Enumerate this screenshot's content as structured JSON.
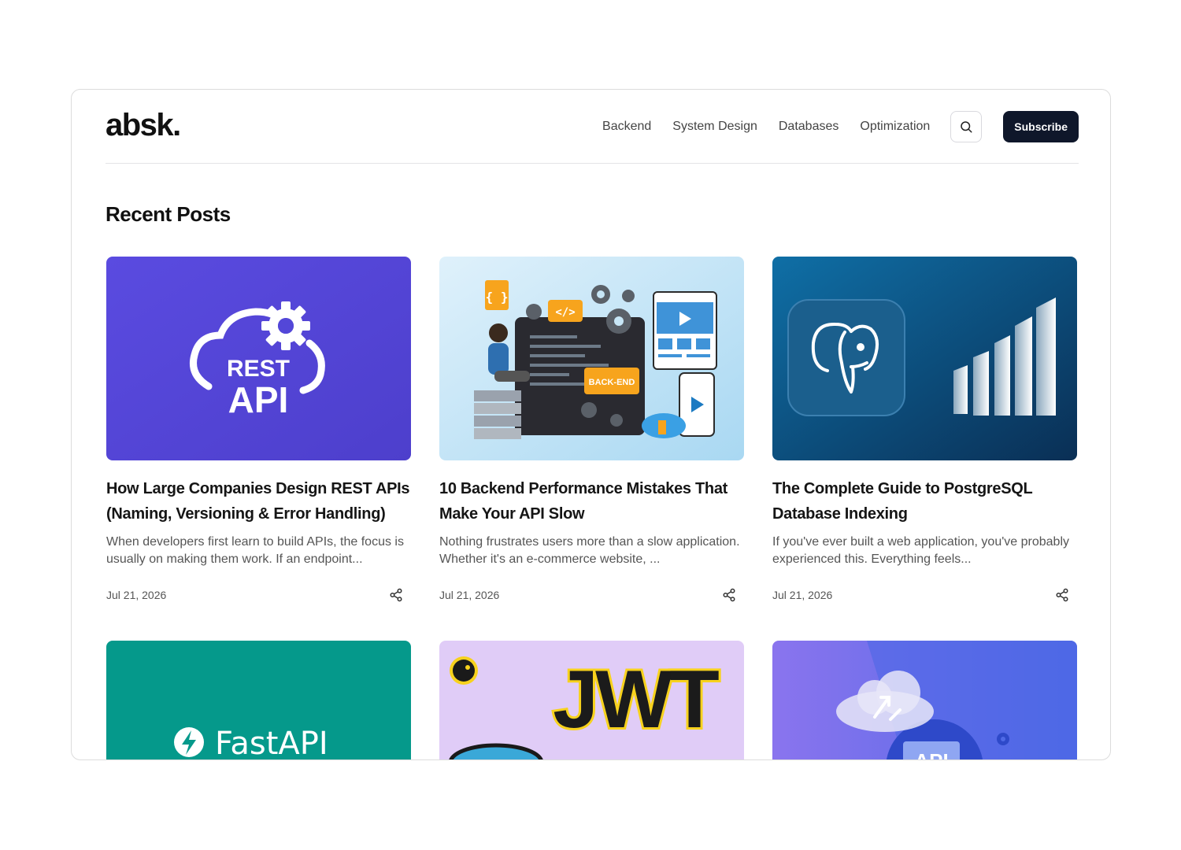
{
  "site": {
    "logo": "absk."
  },
  "nav": {
    "links": [
      "Backend",
      "System Design",
      "Databases",
      "Optimization"
    ],
    "search_icon": "search-icon",
    "subscribe_label": "Subscribe"
  },
  "section": {
    "title": "Recent Posts"
  },
  "posts": [
    {
      "title": "How Large Companies Design REST APIs (Naming, Versioning & Error Handling)",
      "excerpt": "When developers first learn to build APIs, the focus is usually on making them work. If an endpoint...",
      "date": "Jul 21, 2026",
      "thumb_text_1": "REST",
      "thumb_text_2": "API"
    },
    {
      "title": "10 Backend Performance Mistakes That Make Your API Slow",
      "excerpt": "Nothing frustrates users more than a slow application. Whether it's an e-commerce website, ...",
      "date": "Jul 21, 2026",
      "thumb_text_1": "BACK-END",
      "thumb_text_2": "</>"
    },
    {
      "title": "The Complete Guide to PostgreSQL Database Indexing",
      "excerpt": "If you've ever built a web application, you've probably experienced this. Everything feels...",
      "date": "Jul 21, 2026"
    },
    {
      "thumb_text_1": "FastAPI"
    },
    {
      "thumb_text_1": "JWT"
    },
    {
      "thumb_text_1": "API"
    }
  ],
  "colors": {
    "subscribe_bg": "#0f172a",
    "rest_api_bg": "#5546d6",
    "postgres_bg": "#0a5a8a",
    "fastapi_bg": "#05998b",
    "jwt_bg": "#e0ccf7",
    "api_bg": "#5b5be8"
  }
}
